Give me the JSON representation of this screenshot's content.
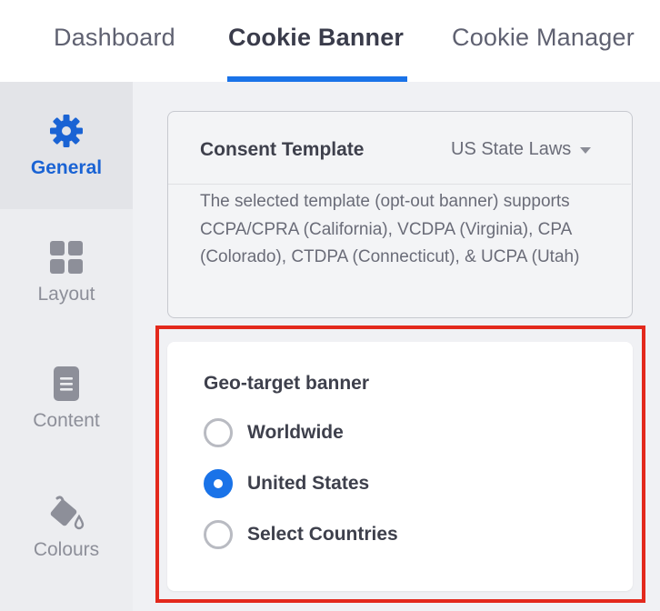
{
  "tabs": [
    {
      "label": "Dashboard",
      "active": false
    },
    {
      "label": "Cookie Banner",
      "active": true
    },
    {
      "label": "Cookie Manager",
      "active": false
    }
  ],
  "sidebar": {
    "items": [
      {
        "label": "General",
        "icon": "gear-icon",
        "active": true
      },
      {
        "label": "Layout",
        "icon": "grid-icon",
        "active": false
      },
      {
        "label": "Content",
        "icon": "document-icon",
        "active": false
      },
      {
        "label": "Colours",
        "icon": "paint-bucket-icon",
        "active": false
      }
    ]
  },
  "consent": {
    "title": "Consent Template",
    "selected_template": "US State Laws",
    "description": "The selected template (opt-out banner) supports CCPA/CPRA (California), VCDPA (Virginia), CPA (Colorado), CTDPA (Connecticut), & UCPA (Utah)"
  },
  "geo": {
    "title": "Geo-target banner",
    "options": [
      {
        "label": "Worldwide",
        "selected": false
      },
      {
        "label": "United States",
        "selected": true
      },
      {
        "label": "Select Countries",
        "selected": false
      }
    ]
  },
  "colors": {
    "accent": "#1a73e8",
    "active_sidebar_text": "#1a63d4",
    "highlight_frame": "#e3291c"
  }
}
